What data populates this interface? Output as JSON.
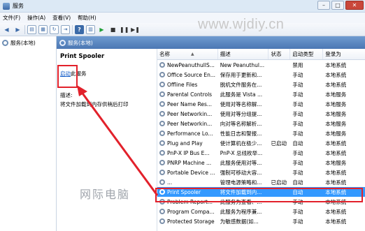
{
  "window": {
    "title": "服务",
    "min": "–",
    "max": "□",
    "close": "✕"
  },
  "menu": {
    "items": [
      "文件(F)",
      "操作(A)",
      "查看(V)",
      "帮助(H)"
    ]
  },
  "watermark": "www.wjdiy.cn",
  "tree": {
    "root_label": "服务(本地)"
  },
  "content_header": "服务(本地)",
  "details": {
    "service_name": "Print Spooler",
    "start_link": "启动",
    "start_suffix": "此服务",
    "desc_label": "描述:",
    "desc_text": "将文件加载到内存供稍后打印"
  },
  "columns": {
    "name": "名称",
    "desc": "描述",
    "status": "状态",
    "startup": "启动类型",
    "logon": "登录为"
  },
  "services": [
    {
      "name": "NewPeanuthullS...",
      "desc": "New Peanuthul...",
      "status": "",
      "startup": "禁用",
      "logon": "本地系统"
    },
    {
      "name": "Office Source En...",
      "desc": "保存用于更新和...",
      "status": "",
      "startup": "手动",
      "logon": "本地系统"
    },
    {
      "name": "Offline Files",
      "desc": "脱机文件服务在...",
      "status": "",
      "startup": "手动",
      "logon": "本地系统"
    },
    {
      "name": "Parental Controls",
      "desc": "此服务是 Vista ...",
      "status": "",
      "startup": "手动",
      "logon": "本地服务"
    },
    {
      "name": "Peer Name Res...",
      "desc": "使用对等名称解...",
      "status": "",
      "startup": "手动",
      "logon": "本地服务"
    },
    {
      "name": "Peer Networkin...",
      "desc": "使用对等分组提...",
      "status": "",
      "startup": "手动",
      "logon": "本地服务"
    },
    {
      "name": "Peer Networkin...",
      "desc": "向对等名称解析...",
      "status": "",
      "startup": "手动",
      "logon": "本地服务"
    },
    {
      "name": "Performance Lo...",
      "desc": "性能日志和警报...",
      "status": "",
      "startup": "手动",
      "logon": "本地服务"
    },
    {
      "name": "Plug and Play",
      "desc": "使计算机在极少...",
      "status": "已启动",
      "startup": "自动",
      "logon": "本地系统"
    },
    {
      "name": "PnP-X IP Bus E...",
      "desc": "PnP-X 总线枚举...",
      "status": "",
      "startup": "手动",
      "logon": "本地系统"
    },
    {
      "name": "PNRP Machine ...",
      "desc": "此服务使用对等...",
      "status": "",
      "startup": "手动",
      "logon": "本地服务"
    },
    {
      "name": "Portable Device ...",
      "desc": "强制可移动大容...",
      "status": "",
      "startup": "手动",
      "logon": "本地系统"
    },
    {
      "name": "...",
      "desc": "管理电源策略和...",
      "status": "已启动",
      "startup": "自动",
      "logon": "本地系统"
    },
    {
      "name": "Print Spooler",
      "desc": "将文件加载到内...",
      "status": "",
      "startup": "自动",
      "logon": "本地系统"
    },
    {
      "name": "Problem Report...",
      "desc": "此服务为查看、...",
      "status": "",
      "startup": "手动",
      "logon": "本地系统"
    },
    {
      "name": "Program Compa...",
      "desc": "此服务为程序兼...",
      "status": "",
      "startup": "手动",
      "logon": "本地系统"
    },
    {
      "name": "Protected Storage",
      "desc": "为敏感数据(如...",
      "status": "",
      "startup": "手动",
      "logon": "本地系统"
    }
  ],
  "brand": "网际电脑",
  "colors": {
    "highlight_box": "#e2212b",
    "selection": "#3399ff",
    "header_blue": "#4b77b3"
  }
}
